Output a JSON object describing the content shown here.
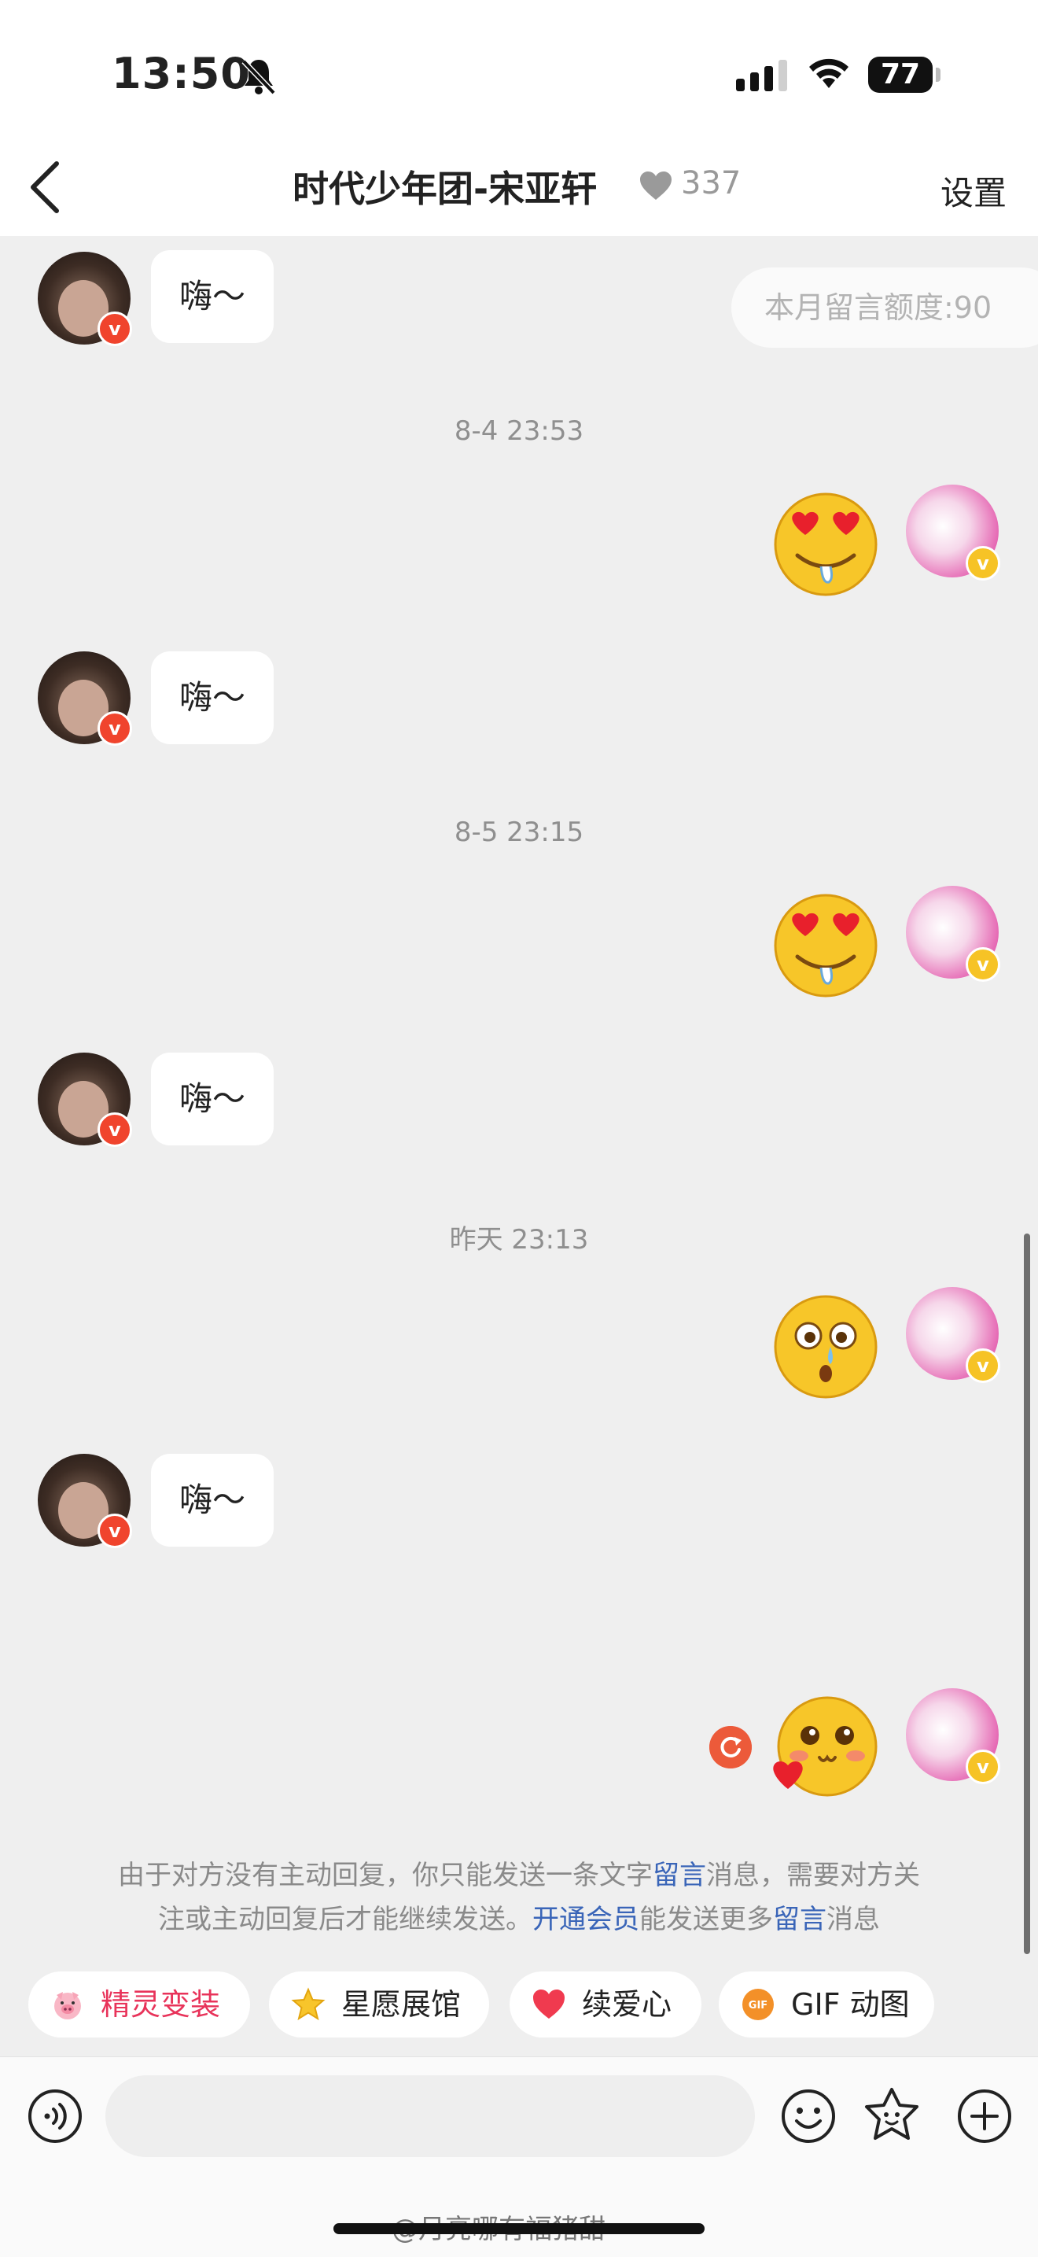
{
  "status_bar": {
    "time": "13:50",
    "battery": "77"
  },
  "nav": {
    "title": "时代少年团-宋亚轩",
    "score": "337",
    "settings": "设置"
  },
  "quota": "本月留言额度:90",
  "messages": {
    "bubble_text": "嗨～",
    "timestamps": [
      "8-4 23:53",
      "8-5 23:15",
      "昨天 23:13"
    ]
  },
  "notice": {
    "line1_a": "由于对方没有主动回复，你只能发送一条文字",
    "line1_link": "留言",
    "line1_b": "消息，需要对方关",
    "line2_a": "注或主动回复后才能继续发送。",
    "line2_link1": "开通会员",
    "line2_b": "能发送更多",
    "line2_link2": "留言",
    "line2_c": "消息"
  },
  "chips": [
    {
      "label": "精灵变装",
      "icon": "pig-icon",
      "color": "#e8335a"
    },
    {
      "label": "星愿展馆",
      "icon": "star-icon",
      "color": "#333333"
    },
    {
      "label": "续爱心",
      "icon": "heart-icon",
      "color": "#333333"
    },
    {
      "label": "GIF 动图",
      "icon": "gif-icon",
      "color": "#333333"
    }
  ],
  "watermark": "@月亮哪有福猪甜",
  "colors": {
    "link": "#3a65b8",
    "verified_red": "#f0442d",
    "verified_gold": "#f6c326",
    "chip_accent": "#e8335a"
  }
}
